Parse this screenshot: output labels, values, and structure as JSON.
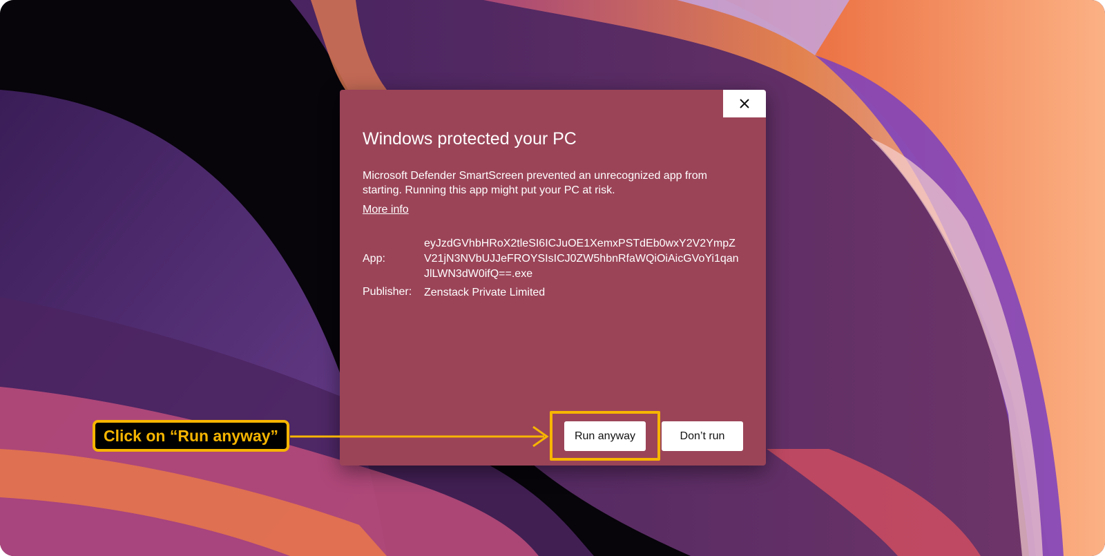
{
  "dialog": {
    "title": "Windows protected your PC",
    "message": "Microsoft Defender SmartScreen prevented an unrecognized app from starting. Running this app might put your PC at risk.",
    "more_info": "More info",
    "app_label": "App:",
    "app_value": "eyJzdGVhbHRoX2tleSI6ICJuOE1XemxPSTdEb0wxY2V2YmpZV21jN3NVbUJJeFROYSIsICJ0ZW5hbnRfaWQiOiAicGVoYi1qanJlLWN3dW0ifQ==.exe",
    "publisher_label": "Publisher:",
    "publisher_value": "Zenstack Private Limited",
    "run_anyway_label": "Run anyway",
    "dont_run_label": "Don’t run",
    "close_icon": "close-icon"
  },
  "annotation": {
    "callout_text": "Click on “Run anyway”",
    "highlight_color": "#f7b500"
  },
  "colors": {
    "dialog_background": "#9b4458",
    "button_background": "#ffffff"
  }
}
